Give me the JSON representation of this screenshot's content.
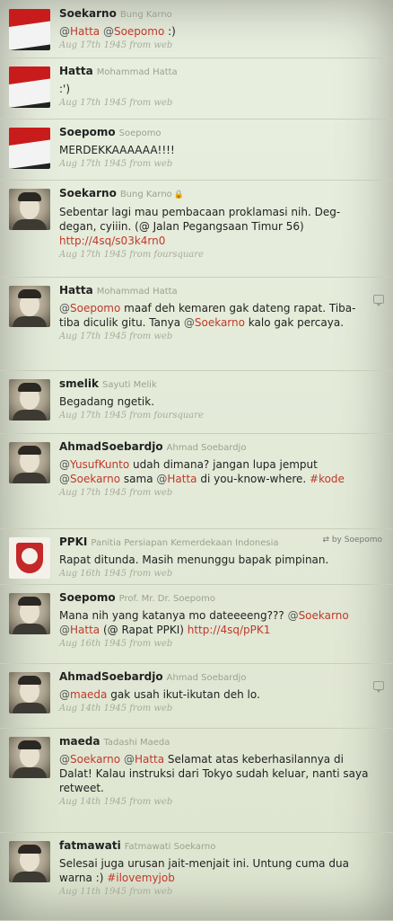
{
  "tweets": [
    {
      "screen": "Soekarno",
      "real": "Bung Karno",
      "avatar": "flag",
      "text_parts": [
        {
          "t": "@",
          "c": "at"
        },
        {
          "t": "Hatta",
          "c": "mention"
        },
        {
          "t": " ",
          "c": ""
        },
        {
          "t": "@",
          "c": "at"
        },
        {
          "t": "Soepomo",
          "c": "mention"
        },
        {
          "t": " :)",
          "c": ""
        }
      ],
      "meta": "Aug 17th 1945 from web"
    },
    {
      "screen": "Hatta",
      "real": "Mohammad Hatta",
      "avatar": "flag",
      "text_parts": [
        {
          "t": ":')",
          "c": ""
        }
      ],
      "meta": "Aug 17th 1945 from web"
    },
    {
      "screen": "Soepomo",
      "real": "Soepomo",
      "avatar": "flag",
      "text_parts": [
        {
          "t": "MERDEKKAAAAAA!!!!",
          "c": ""
        }
      ],
      "meta": "Aug 17th 1945 from web"
    },
    {
      "screen": "Soekarno",
      "real": "Bung Karno",
      "lock": true,
      "avatar": "photo",
      "text_parts": [
        {
          "t": "Sebentar lagi mau pembacaan proklamasi nih. Deg-degan, cyiiin. (@ Jalan Pegangsaan Timur 56) ",
          "c": ""
        },
        {
          "t": "http://4sq/s03k4rn0",
          "c": "link"
        }
      ],
      "meta": "Aug 17th 1945 from foursquare"
    },
    {
      "screen": "Hatta",
      "real": "Mohammad Hatta",
      "avatar": "photo",
      "reply": true,
      "text_parts": [
        {
          "t": "@",
          "c": "at"
        },
        {
          "t": "Soepomo",
          "c": "mention"
        },
        {
          "t": " maaf deh kemaren gak dateng rapat. Tiba-tiba diculik gitu. Tanya ",
          "c": ""
        },
        {
          "t": "@",
          "c": "at"
        },
        {
          "t": "Soekarno",
          "c": "mention"
        },
        {
          "t": " kalo gak percaya.",
          "c": ""
        }
      ],
      "meta": "Aug 17th 1945 from web"
    },
    {
      "screen": "smelik",
      "real": "Sayuti Melik",
      "avatar": "photo",
      "text_parts": [
        {
          "t": "Begadang ngetik.",
          "c": ""
        }
      ],
      "meta": "Aug 17th 1945 from foursquare"
    },
    {
      "screen": "AhmadSoebardjo",
      "real": "Ahmad Soebardjo",
      "avatar": "photo",
      "text_parts": [
        {
          "t": "@",
          "c": "at"
        },
        {
          "t": "YusufKunto",
          "c": "mention"
        },
        {
          "t": " udah dimana? jangan lupa jemput ",
          "c": ""
        },
        {
          "t": "@",
          "c": "at"
        },
        {
          "t": "Soekarno",
          "c": "mention"
        },
        {
          "t": " sama ",
          "c": ""
        },
        {
          "t": "@",
          "c": "at"
        },
        {
          "t": "Hatta",
          "c": "mention"
        },
        {
          "t": " di you-know-where. ",
          "c": ""
        },
        {
          "t": "#kode",
          "c": "tag"
        }
      ],
      "meta": "Aug 17th 1945 from web"
    },
    {
      "screen": "PPKI",
      "real": "Panitia Persiapan Kemerdekaan Indonesia",
      "avatar": "logo",
      "retweet": "by Soepomo",
      "text_parts": [
        {
          "t": "Rapat ditunda. Masih menunggu bapak pimpinan.",
          "c": ""
        }
      ],
      "meta": "Aug 16th 1945 from web"
    },
    {
      "screen": "Soepomo",
      "real": "Prof. Mr. Dr. Soepomo",
      "avatar": "photo",
      "text_parts": [
        {
          "t": "Mana nih yang katanya mo dateeeeng??? ",
          "c": ""
        },
        {
          "t": "@",
          "c": "at"
        },
        {
          "t": "Soekarno",
          "c": "mention"
        },
        {
          "t": " ",
          "c": ""
        },
        {
          "t": "@",
          "c": "at"
        },
        {
          "t": "Hatta",
          "c": "mention"
        },
        {
          "t": " (@ Rapat PPKI) ",
          "c": ""
        },
        {
          "t": "http://4sq/pPK1",
          "c": "link"
        }
      ],
      "meta": "Aug 16th 1945 from web"
    },
    {
      "screen": "AhmadSoebardjo",
      "real": "Ahmad Soebardjo",
      "avatar": "photo",
      "reply": true,
      "text_parts": [
        {
          "t": "@",
          "c": "at"
        },
        {
          "t": "maeda",
          "c": "mention"
        },
        {
          "t": " gak usah ikut-ikutan deh lo.",
          "c": ""
        }
      ],
      "meta": "Aug 14th 1945 from web"
    },
    {
      "screen": "maeda",
      "real": "Tadashi Maeda",
      "avatar": "photo",
      "text_parts": [
        {
          "t": "@",
          "c": "at"
        },
        {
          "t": "Soekarno",
          "c": "mention"
        },
        {
          "t": " ",
          "c": ""
        },
        {
          "t": "@",
          "c": "at"
        },
        {
          "t": "Hatta",
          "c": "mention"
        },
        {
          "t": " Selamat atas keberhasilannya di Dalat! Kalau instruksi dari Tokyo sudah keluar, nanti saya retweet.",
          "c": ""
        }
      ],
      "meta": "Aug 14th 1945 from web"
    },
    {
      "screen": "fatmawati",
      "real": "Fatmawati Soekarno",
      "avatar": "photo",
      "text_parts": [
        {
          "t": "Selesai juga urusan jait-menjait ini. Untung cuma dua warna :) ",
          "c": ""
        },
        {
          "t": "#ilovemyjob",
          "c": "tag"
        }
      ],
      "meta": "Aug 11th 1945 from web"
    }
  ]
}
